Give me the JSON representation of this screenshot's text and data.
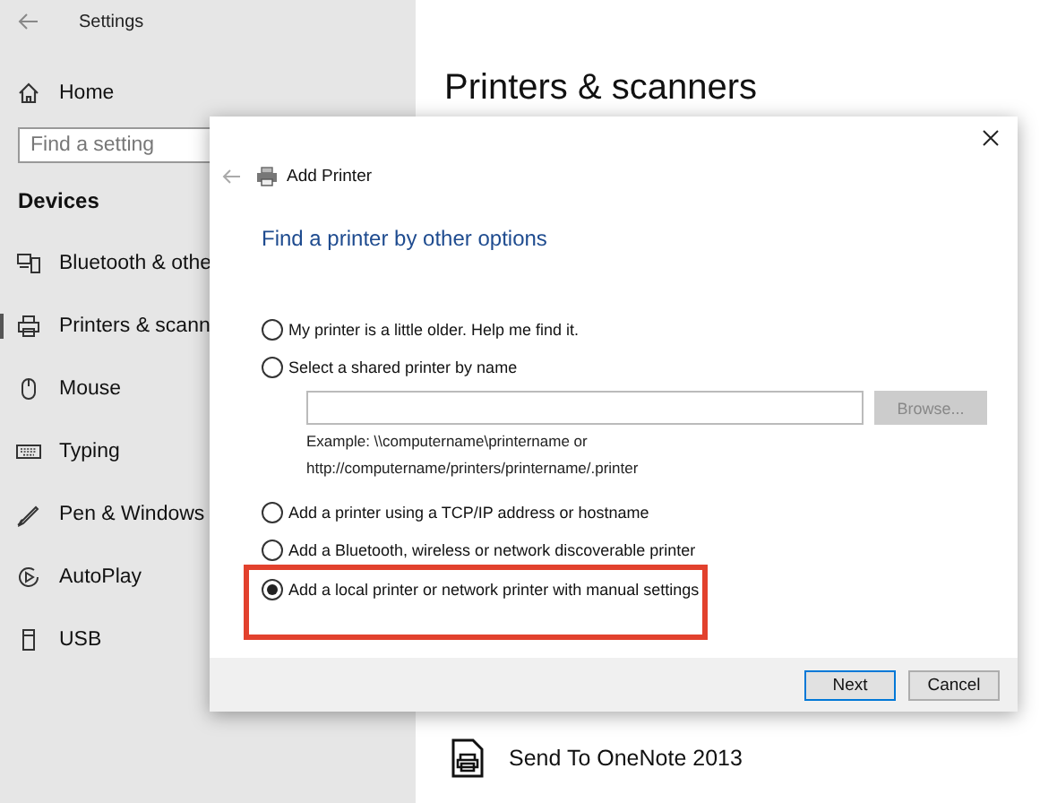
{
  "settings": {
    "title": "Settings",
    "home": "Home",
    "search": {
      "placeholder": "Find a setting"
    },
    "section": "Devices",
    "items": [
      {
        "label": "Bluetooth & othe",
        "selected": false
      },
      {
        "label": "Printers & scann",
        "selected": true
      },
      {
        "label": "Mouse",
        "selected": false
      },
      {
        "label": "Typing",
        "selected": false
      },
      {
        "label": "Pen & Windows",
        "selected": false
      },
      {
        "label": "AutoPlay",
        "selected": false
      },
      {
        "label": "USB",
        "selected": false
      }
    ],
    "page_title": "Printers & scanners",
    "device": "Send To OneNote 2013"
  },
  "dialog": {
    "title": "Add Printer",
    "heading": "Find a printer by other options",
    "options": [
      {
        "label": "My printer is a little older. Help me find it.",
        "selected": false,
        "highlighted": false
      },
      {
        "label": "Select a shared printer by name",
        "selected": false,
        "highlighted": false
      },
      {
        "label": "Add a printer using a TCP/IP address or hostname",
        "selected": false,
        "highlighted": false
      },
      {
        "label": "Add a Bluetooth, wireless or network discoverable printer",
        "selected": false,
        "highlighted": false
      },
      {
        "label": "Add a local printer or network printer with manual settings",
        "selected": true,
        "highlighted": true
      }
    ],
    "browse": {
      "label": "Browse...",
      "disabled": true
    },
    "example": [
      "Example: \\\\computername\\printername or",
      "http://computername/printers/printername/.printer"
    ],
    "buttons": [
      {
        "label": "Next",
        "default": true
      },
      {
        "label": "Cancel",
        "default": false
      }
    ]
  }
}
